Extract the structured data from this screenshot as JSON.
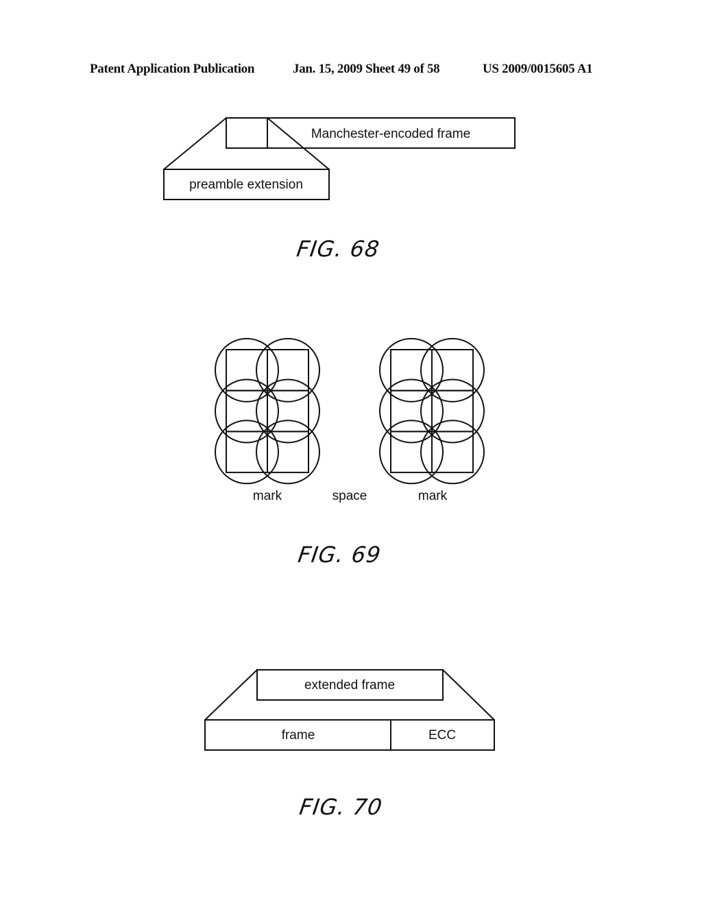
{
  "header": {
    "publication": "Patent Application Publication",
    "date_sheet": "Jan. 15, 2009  Sheet 49 of 58",
    "patent_number": "US 2009/0015605 A1"
  },
  "fig68": {
    "frame_label": "Manchester-encoded frame",
    "expansion_label": "preamble extension",
    "caption": "FIG. 68"
  },
  "fig69": {
    "labels": [
      "mark",
      "space",
      "mark"
    ],
    "caption": "FIG. 69"
  },
  "fig70": {
    "top_label": "extended frame",
    "bottom_labels": [
      "frame",
      "ECC"
    ],
    "caption": "FIG. 70"
  }
}
